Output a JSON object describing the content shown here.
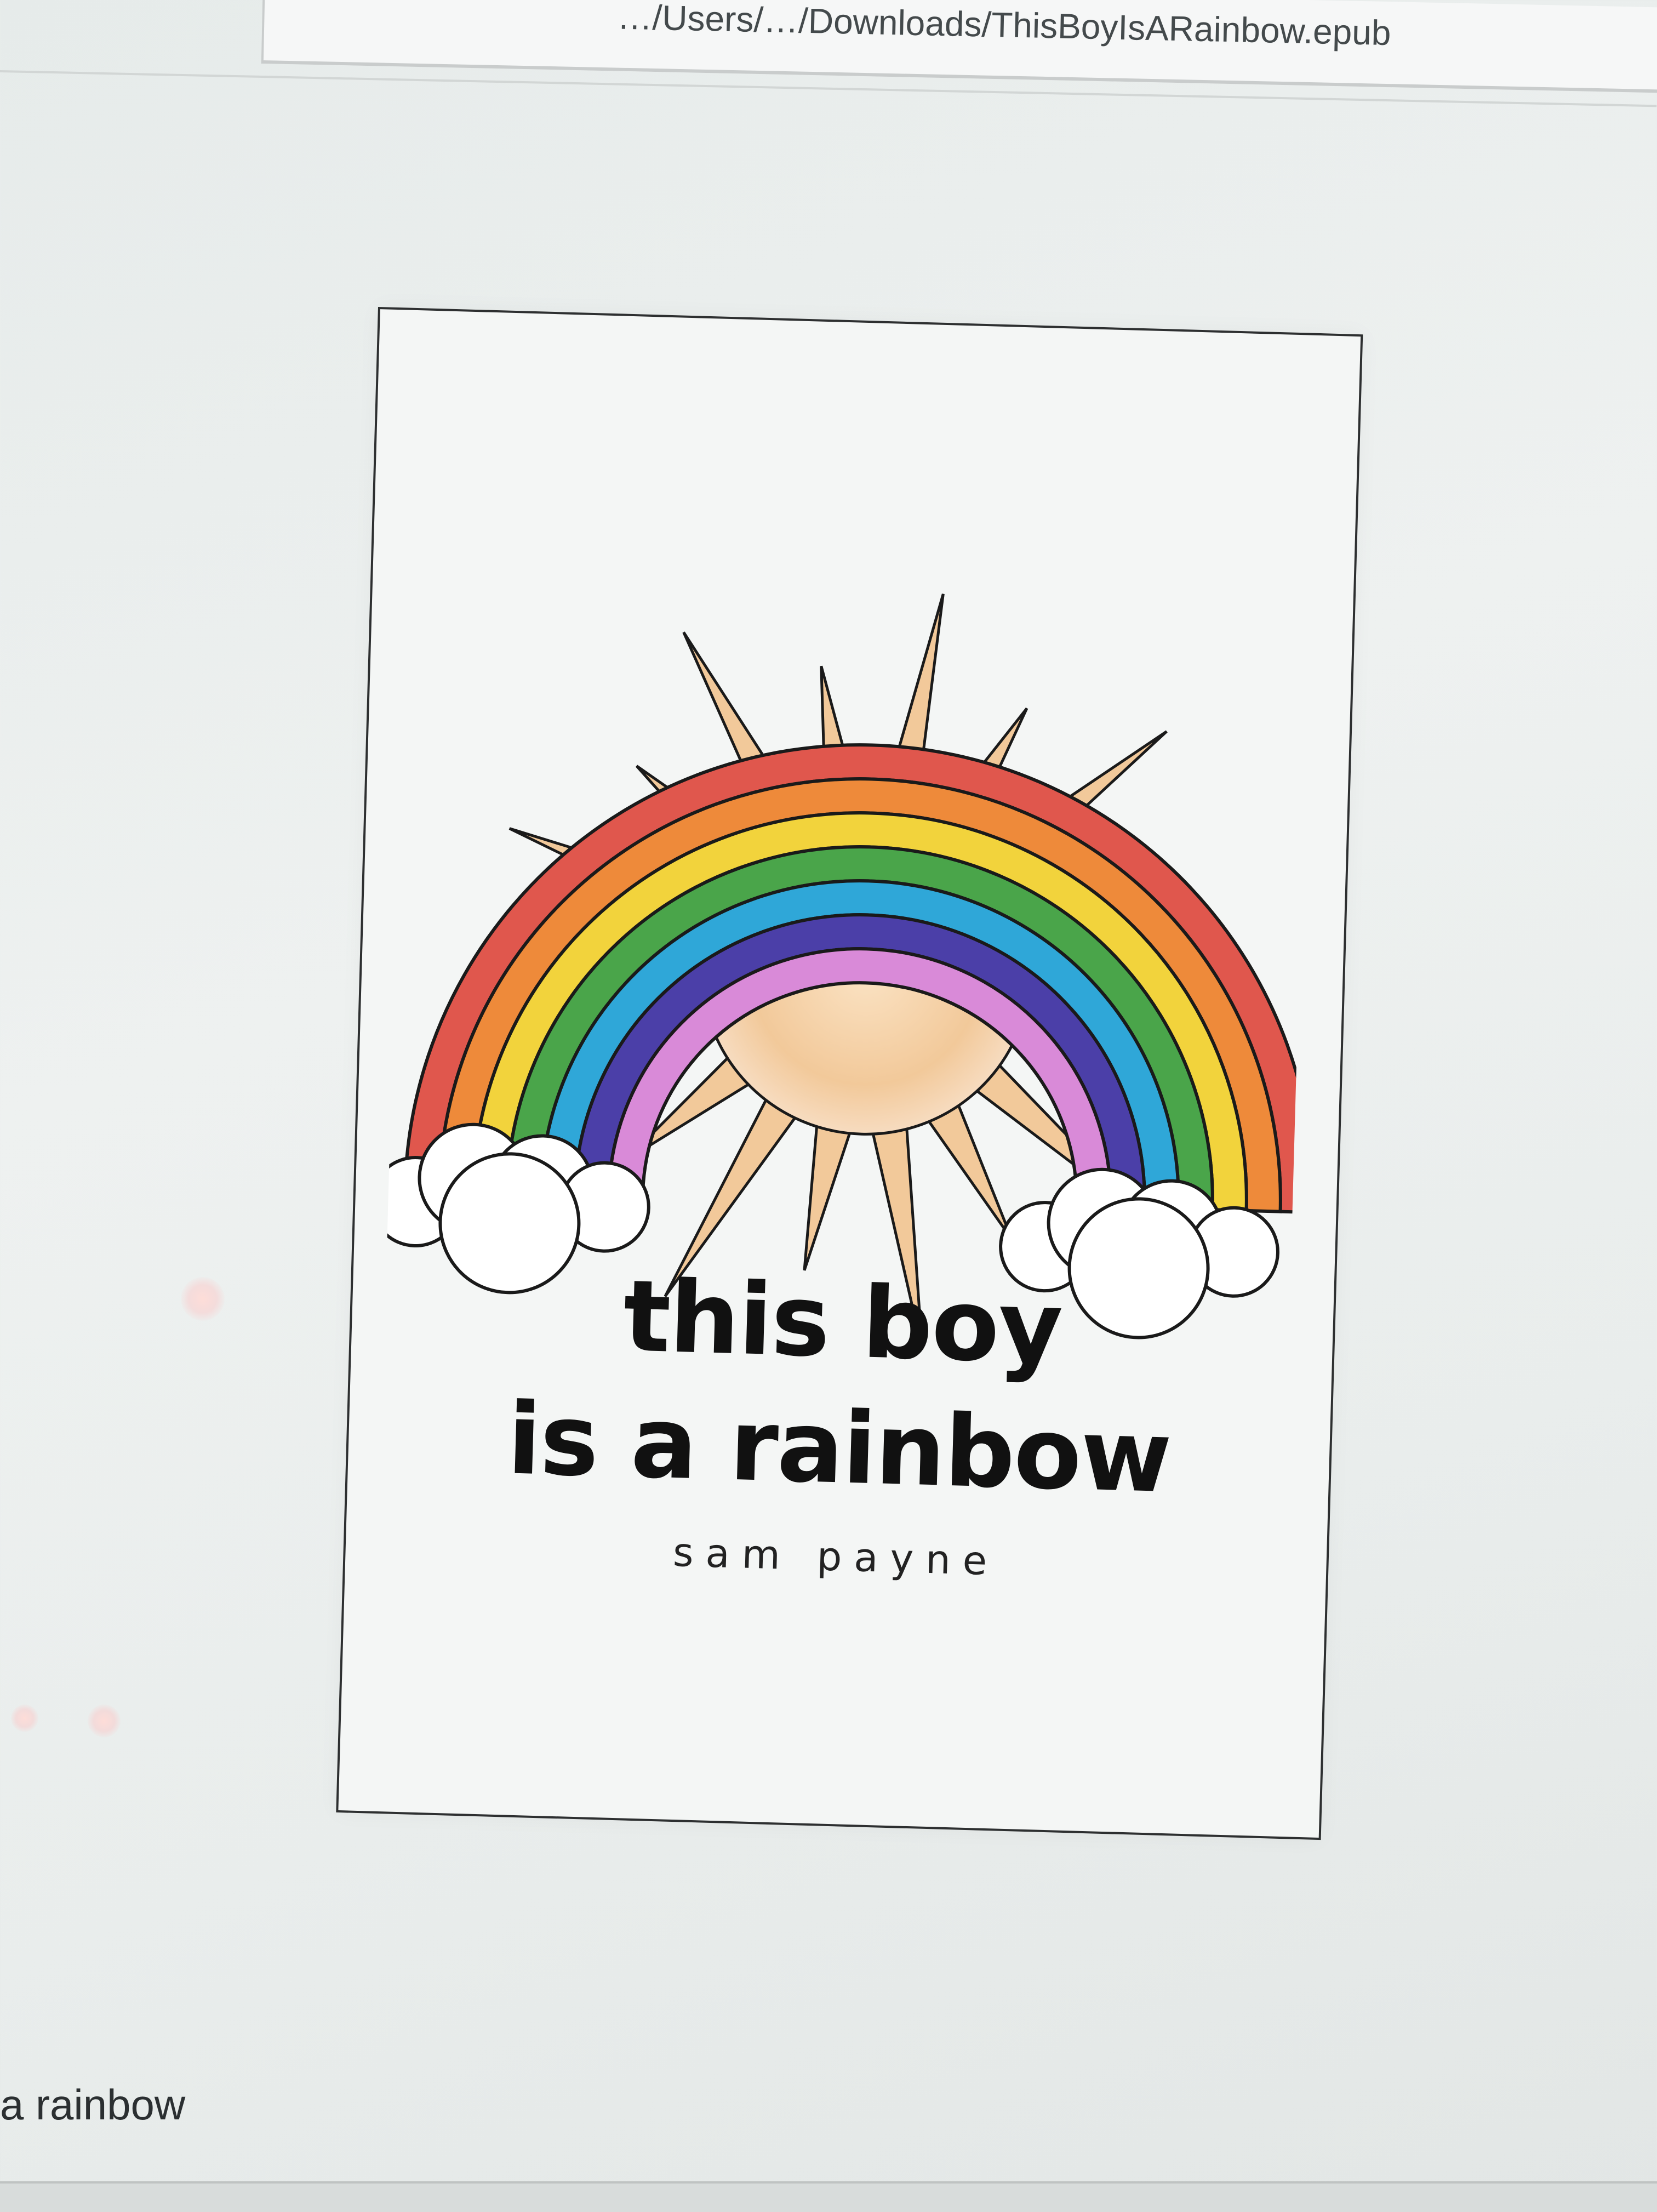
{
  "window": {
    "address": "…/Users/…/Downloads/ThisBoyIsARainbow.epub"
  },
  "book": {
    "title_line_1": "this boy",
    "title_line_2": "is a rainbow",
    "author": "sam payne"
  },
  "footer": {
    "label": "a rainbow"
  },
  "colors": {
    "rainbow": [
      "#e0574d",
      "#ee8a3a",
      "#f2d33c",
      "#4aa54a",
      "#2fa7d8",
      "#4b3fa8",
      "#d98ad8"
    ],
    "sun": "#f2c99a",
    "outline": "#1a1a1a"
  }
}
